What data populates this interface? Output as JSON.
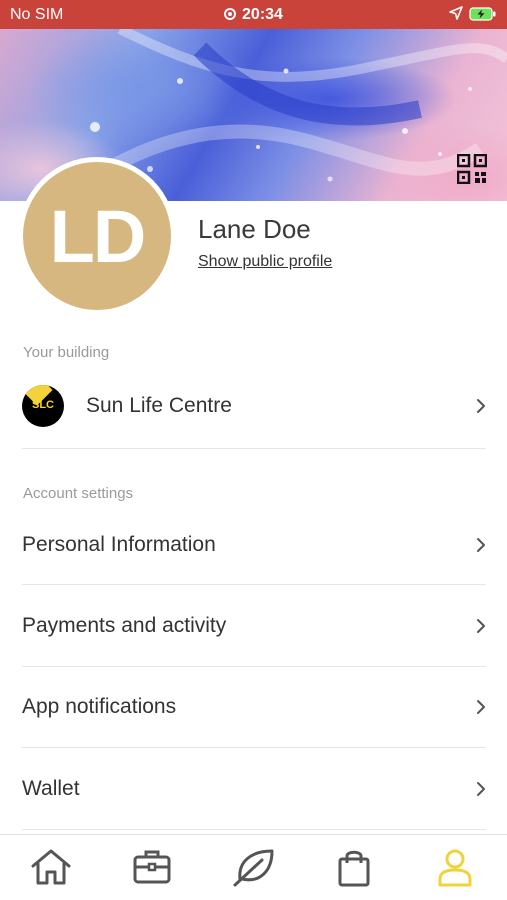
{
  "status_bar": {
    "carrier": "No SIM",
    "time": "20:34"
  },
  "profile": {
    "initials": "LD",
    "name": "Lane Doe",
    "public_profile_link": "Show public profile",
    "avatar_color": "#d5b77f"
  },
  "building_section": {
    "label": "Your building",
    "building": {
      "name": "Sun Life Centre",
      "logo_text": "SLC"
    }
  },
  "account_section": {
    "label": "Account settings",
    "items": [
      {
        "label": "Personal Information"
      },
      {
        "label": "Payments and activity"
      },
      {
        "label": "App notifications"
      },
      {
        "label": "Wallet"
      }
    ]
  },
  "tab_bar": {
    "tabs": [
      {
        "icon": "home-icon",
        "active": false
      },
      {
        "icon": "briefcase-icon",
        "active": false
      },
      {
        "icon": "leaf-icon",
        "active": false
      },
      {
        "icon": "shopping-bag-icon",
        "active": false
      },
      {
        "icon": "user-icon",
        "active": true
      }
    ],
    "active_color": "#f0d23c",
    "inactive_color": "#555555"
  },
  "colors": {
    "status_bar": "#c9433a",
    "accent": "#f0d23c"
  }
}
